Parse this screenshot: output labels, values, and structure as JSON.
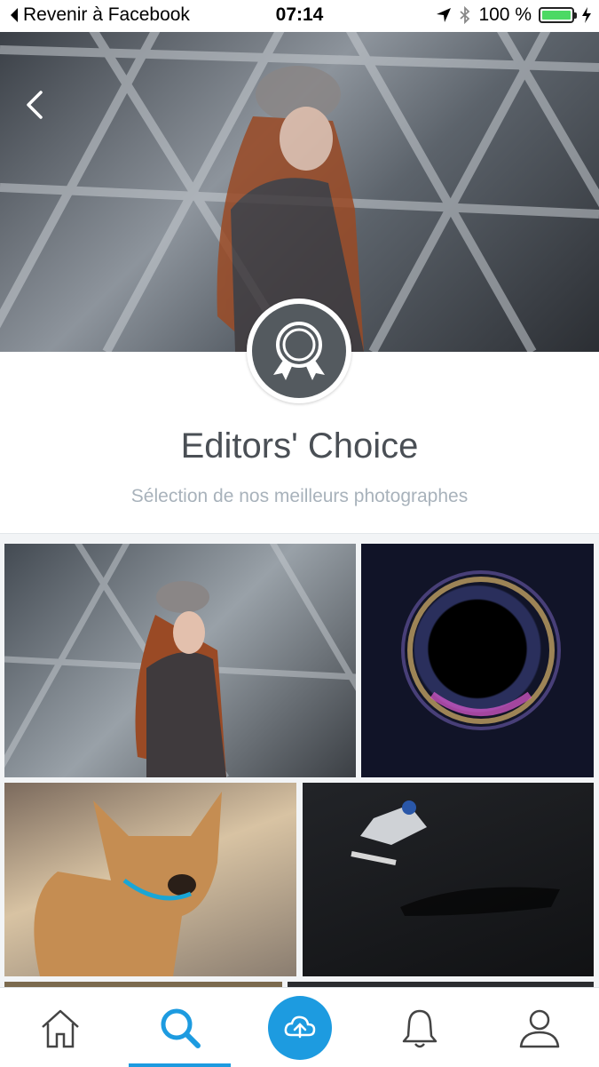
{
  "status_bar": {
    "back_app": "Revenir à Facebook",
    "time": "07:14",
    "battery": "100 %",
    "battery_level": 1.0
  },
  "header": {
    "title": "Editors' Choice",
    "subtitle": "Sélection de nos meilleurs photographes"
  },
  "icons": {
    "back": "chevron-left-icon",
    "badge": "award-ribbon-icon",
    "home": "home-icon",
    "search": "search-icon",
    "upload": "cloud-upload-icon",
    "notifications": "bell-icon",
    "profile": "user-icon"
  },
  "colors": {
    "accent": "#1d9be0",
    "title_text": "#4a4f55",
    "subtitle_text": "#a8b2bb",
    "badge_fill": "#545a5f"
  }
}
